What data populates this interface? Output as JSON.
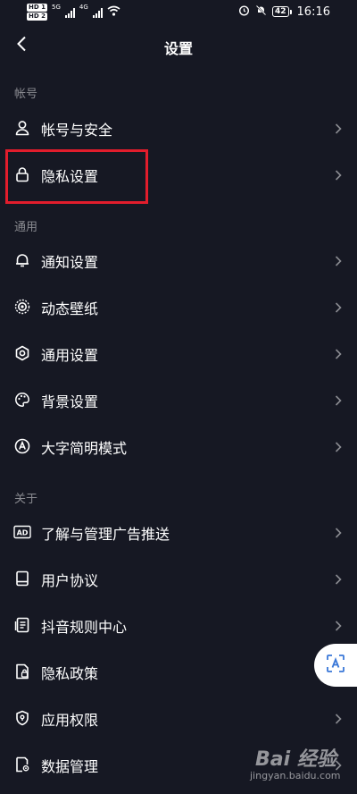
{
  "status_bar": {
    "hd1": "HD 1",
    "hd2": "HD 2",
    "net1": "5G",
    "net2": "4G",
    "battery": "42",
    "time": "16:16"
  },
  "header": {
    "title": "设置"
  },
  "sections": [
    {
      "title": "帐号"
    },
    {
      "title": "通用"
    },
    {
      "title": "关于"
    }
  ],
  "items": [
    {
      "label": "帐号与安全",
      "icon": "user-icon"
    },
    {
      "label": "隐私设置",
      "icon": "lock-icon"
    },
    {
      "label": "通知设置",
      "icon": "bell-icon"
    },
    {
      "label": "动态壁纸",
      "icon": "wallpaper-icon"
    },
    {
      "label": "通用设置",
      "icon": "gear-icon"
    },
    {
      "label": "背景设置",
      "icon": "palette-icon"
    },
    {
      "label": "大字简明模式",
      "icon": "large-font-icon"
    },
    {
      "label": "了解与管理广告推送",
      "icon": "ad-icon"
    },
    {
      "label": "用户协议",
      "icon": "book-icon"
    },
    {
      "label": "抖音规则中心",
      "icon": "rules-icon"
    },
    {
      "label": "隐私政策",
      "icon": "privacy-doc-icon"
    },
    {
      "label": "应用权限",
      "icon": "shield-icon"
    },
    {
      "label": "数据管理",
      "icon": "data-icon"
    }
  ],
  "colors": {
    "background": "#161823",
    "highlight": "#e21d2c",
    "section_text": "#8a8b91"
  },
  "watermark": {
    "brand": "Bai 经验",
    "url": "jingyan.baidu.com"
  }
}
